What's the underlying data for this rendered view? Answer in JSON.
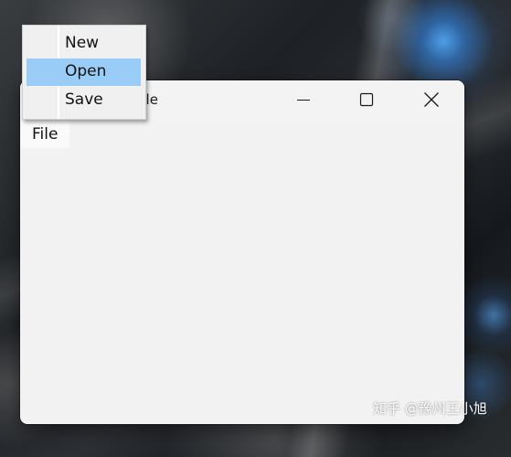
{
  "window": {
    "title": "Example",
    "visible_title_fragment": "ple",
    "controls": {
      "minimize_icon": "minimize-icon",
      "maximize_icon": "maximize-icon",
      "close_icon": "close-icon"
    }
  },
  "menubar": {
    "items": [
      {
        "label": "File",
        "state": "open"
      }
    ]
  },
  "file_menu": {
    "items": [
      {
        "label": "New"
      },
      {
        "label": "Open",
        "highlighted": true
      },
      {
        "label": "Save"
      }
    ],
    "highlight_color": "#99cdf7"
  },
  "watermark": {
    "text": "知乎 @豫州王小旭"
  }
}
